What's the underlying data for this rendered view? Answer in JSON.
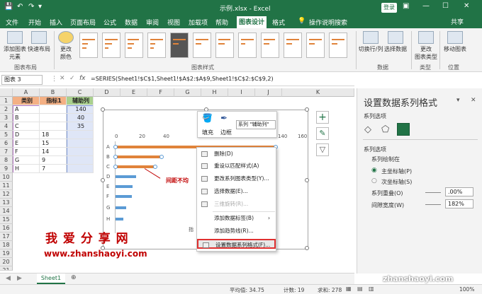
{
  "window": {
    "title": "示例.xlsx - Excel",
    "login_label": "登录"
  },
  "tabs": [
    "文件",
    "开始",
    "插入",
    "页面布局",
    "公式",
    "数据",
    "审阅",
    "视图",
    "加载项",
    "帮助",
    "图表设计",
    "格式"
  ],
  "tell_me": "操作说明搜索",
  "share": "共享",
  "ribbon": {
    "add_element": "添加图表\n元素",
    "quick_layout": "快速布局",
    "change_colors": "更改\n颜色",
    "switch_rowcol": "切换行/列",
    "select_data": "选择数据",
    "change_type": "更改\n图表类型",
    "move_chart": "移动图表",
    "groups": {
      "layouts": "图表布局",
      "styles": "图表样式",
      "data": "数据",
      "type": "类型",
      "location": "位置"
    }
  },
  "formula_bar": {
    "name_box": "图表 3",
    "fx": "fx",
    "formula": "=SERIES(Sheet1!$C$1,Sheet1!$A$2:$A$9,Sheet1!$C$2:$C$9,2)"
  },
  "grid": {
    "columns": [
      "A",
      "B",
      "C",
      "D",
      "E",
      "F",
      "G",
      "H",
      "I",
      "J",
      "K"
    ],
    "rows": [
      "1",
      "2",
      "3",
      "4",
      "5",
      "6",
      "7",
      "8",
      "9",
      "10",
      "11",
      "12",
      "13",
      "14",
      "15",
      "16",
      "17",
      "18",
      "19",
      "20",
      "21"
    ],
    "headers": [
      "类别",
      "指标1",
      "辅助列"
    ],
    "data": [
      [
        "A",
        "",
        "140"
      ],
      [
        "B",
        "",
        "40"
      ],
      [
        "C",
        "",
        "35"
      ],
      [
        "D",
        "18",
        ""
      ],
      [
        "E",
        "15",
        ""
      ],
      [
        "F",
        "14",
        ""
      ],
      [
        "G",
        "9",
        ""
      ],
      [
        "H",
        "7",
        ""
      ]
    ]
  },
  "chart": {
    "title_partial": "图",
    "x_ticks": [
      "0",
      "20",
      "40",
      "60",
      "80",
      "100",
      "120",
      "140",
      "160"
    ],
    "categories": [
      "A",
      "B",
      "C",
      "D",
      "E",
      "F",
      "G",
      "H"
    ],
    "annotation": "间距不均",
    "legend_partial": "指"
  },
  "chart_data": {
    "type": "bar",
    "categories": [
      "A",
      "B",
      "C",
      "D",
      "E",
      "F",
      "G",
      "H"
    ],
    "series": [
      {
        "name": "指标1",
        "values": [
          null,
          null,
          null,
          18,
          15,
          14,
          9,
          7
        ],
        "color": "#5b9bd5"
      },
      {
        "name": "辅助列",
        "values": [
          140,
          40,
          35,
          null,
          null,
          null,
          null,
          null
        ],
        "color": "#e0833a"
      }
    ],
    "xlim": [
      0,
      160
    ]
  },
  "mini_toolbar": {
    "fill": "填充",
    "outline": "边框",
    "series_select": "系列 \"辅助列\""
  },
  "context_menu": [
    {
      "label": "删除(D)",
      "disabled": false
    },
    {
      "label": "重设以匹配样式(A)",
      "disabled": false
    },
    {
      "label": "更改系列图表类型(Y)...",
      "disabled": false
    },
    {
      "label": "选择数据(E)...",
      "disabled": false
    },
    {
      "label": "三维旋转(R)...",
      "disabled": true
    },
    {
      "label": "添加数据标签(B)",
      "disabled": false
    },
    {
      "label": "添加趋势线(R)...",
      "disabled": false
    },
    {
      "label": "设置数据系列格式(F)...",
      "disabled": false
    }
  ],
  "panel": {
    "title": "设置数据系列格式",
    "series_options_dropdown": "系列选项",
    "section": "系列选项",
    "plot_on": "系列绘制在",
    "primary_axis": "主坐标轴(P)",
    "secondary_axis": "次坐标轴(S)",
    "overlap_label": "系列重叠(O)",
    "overlap_value": ".00%",
    "gap_label": "间隙宽度(W)",
    "gap_value": "182%"
  },
  "sheet_tab": "Sheet1",
  "status": {
    "average": "平均值: 34.75",
    "count": "计数: 19",
    "sum": "求和: 278",
    "zoom": "100%"
  },
  "watermark": {
    "line1": "我 爱 分 享 网",
    "line2": "www.zhanshaoyi.com",
    "corner": "zhanshaoyi.com"
  }
}
